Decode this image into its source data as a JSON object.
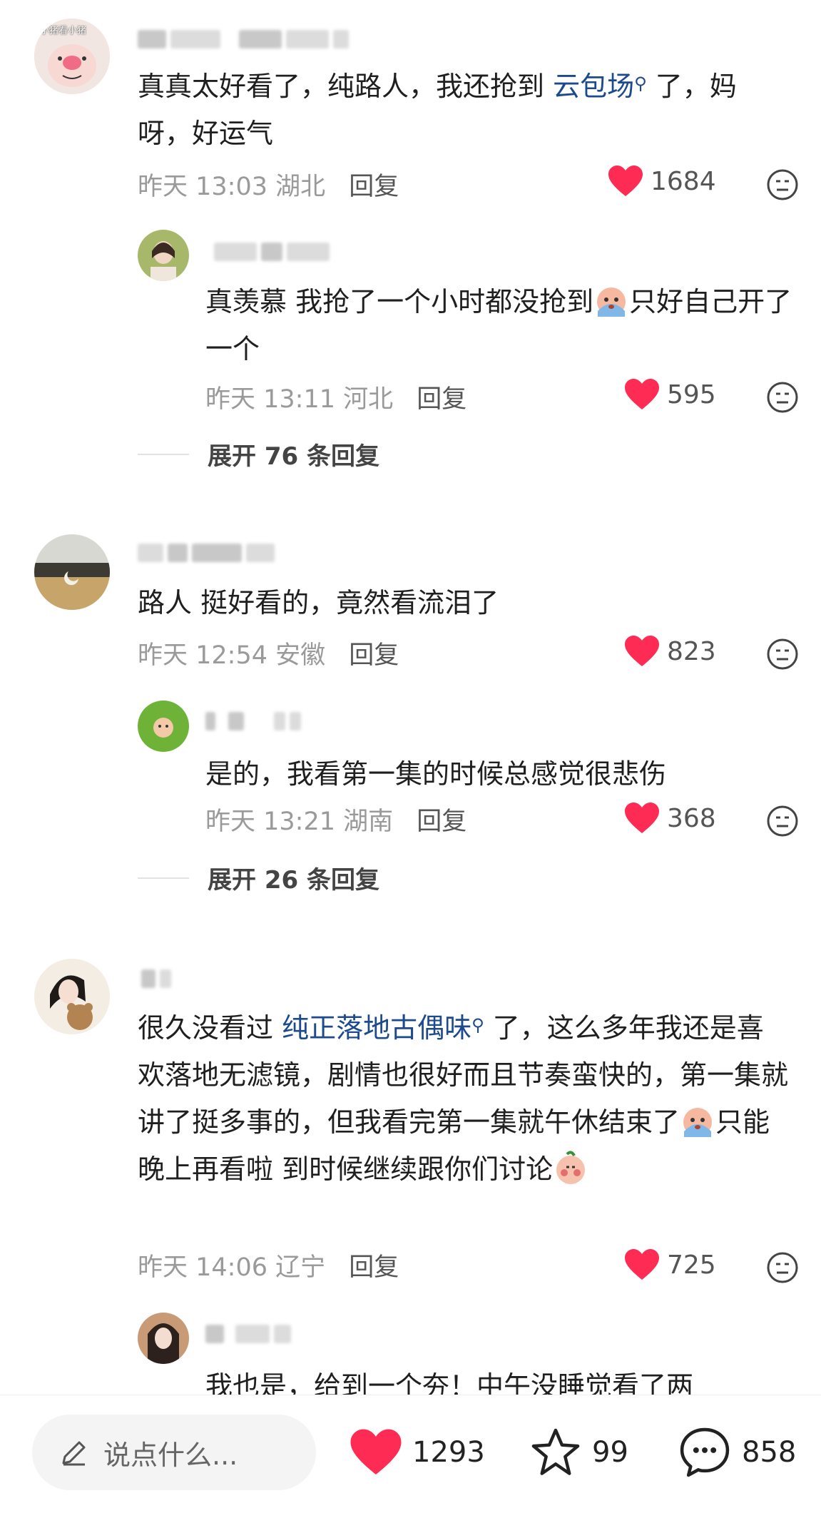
{
  "comments": [
    {
      "avatar_label": "小猪看小猪",
      "text_parts": [
        "真真太好看了，纯路人，我还抢到 ",
        "云包场",
        " 了，妈呀，好运气"
      ],
      "time": "昨天 13:03",
      "location": "湖北",
      "reply_label": "回复",
      "likes": "1684"
    },
    {
      "text_a": "真羡慕 我抢了一个小时都没抢到",
      "text_b": "只好自己开了一个",
      "time": "昨天 13:11",
      "location": "河北",
      "reply_label": "回复",
      "likes": "595"
    },
    {
      "text": "路人 挺好看的，竟然看流泪了",
      "time": "昨天 12:54",
      "location": "安徽",
      "reply_label": "回复",
      "likes": "823"
    },
    {
      "text": "是的，我看第一集的时候总感觉很悲伤",
      "time": "昨天 13:21",
      "location": "湖南",
      "reply_label": "回复",
      "likes": "368"
    },
    {
      "text_a": "很久没看过 ",
      "link": "纯正落地古偶味",
      "text_b": " 了，这么多年我还是喜欢落地无滤镜，剧情也很好而且节奏蛮快的，第一集就讲了挺多事的，但我看完第一集就午休结束了",
      "text_c": "只能晚上再看啦 到时候继续跟你们讨论",
      "time": "昨天 14:06",
      "location": "辽宁",
      "reply_label": "回复",
      "likes": "725"
    },
    {
      "text": "我也是，给到一个夯！中午没睡觉看了两"
    }
  ],
  "expand": [
    {
      "label": "展开 76 条回复"
    },
    {
      "label": "展开 26 条回复"
    }
  ],
  "bottom_bar": {
    "input_placeholder": "说点什么...",
    "likes": "1293",
    "favorites": "99",
    "comments": "858"
  },
  "colors": {
    "like_red": "#fe2c55",
    "link_blue": "#1d4a8c",
    "meta_gray": "#9a9a9a"
  }
}
